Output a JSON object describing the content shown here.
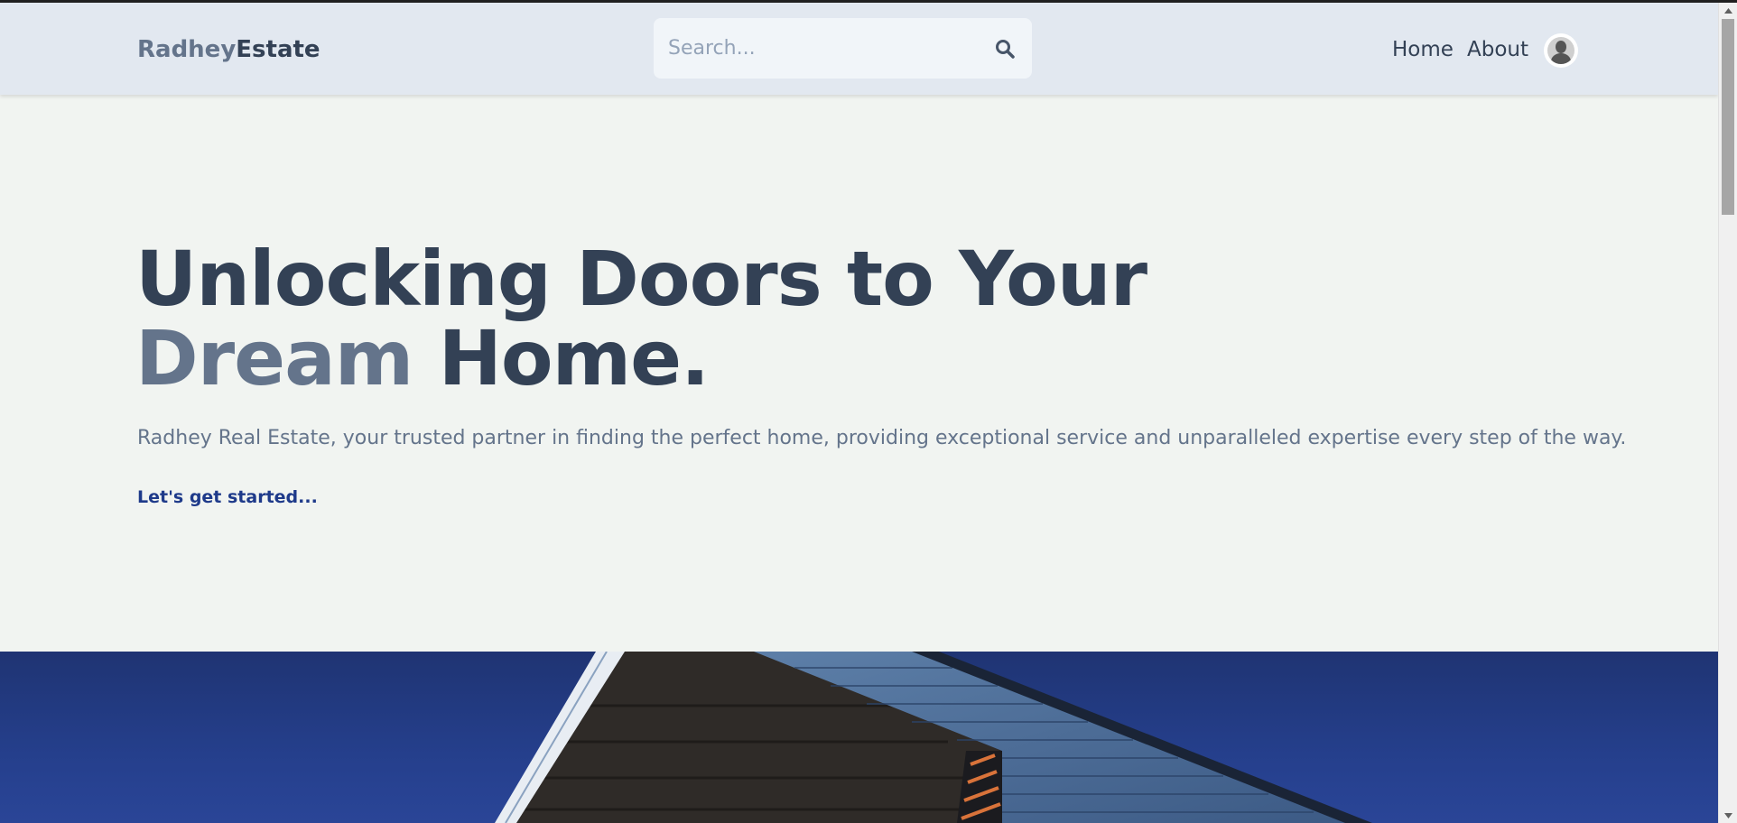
{
  "header": {
    "logo_part1": "Radhey",
    "logo_part2": "Estate",
    "search_placeholder": "Search...",
    "search_icon": "search-icon",
    "nav": [
      {
        "label": "Home"
      },
      {
        "label": "About"
      }
    ],
    "avatar_icon": "user-avatar-icon"
  },
  "hero": {
    "title_line1": "Unlocking Doors to Your",
    "title_accent": "Dream",
    "title_rest": " Home.",
    "description": "Radhey Real Estate, your trusted partner in finding the perfect home, providing exceptional service and unparalleled expertise every step of the way.",
    "cta": "Let's get started..."
  },
  "colors": {
    "header_bg": "#e2e8f0",
    "page_bg": "#f1f4f1",
    "text_dark": "#334155",
    "text_muted": "#64748b",
    "cta": "#1e3a8a",
    "sky": "#253f8c"
  }
}
